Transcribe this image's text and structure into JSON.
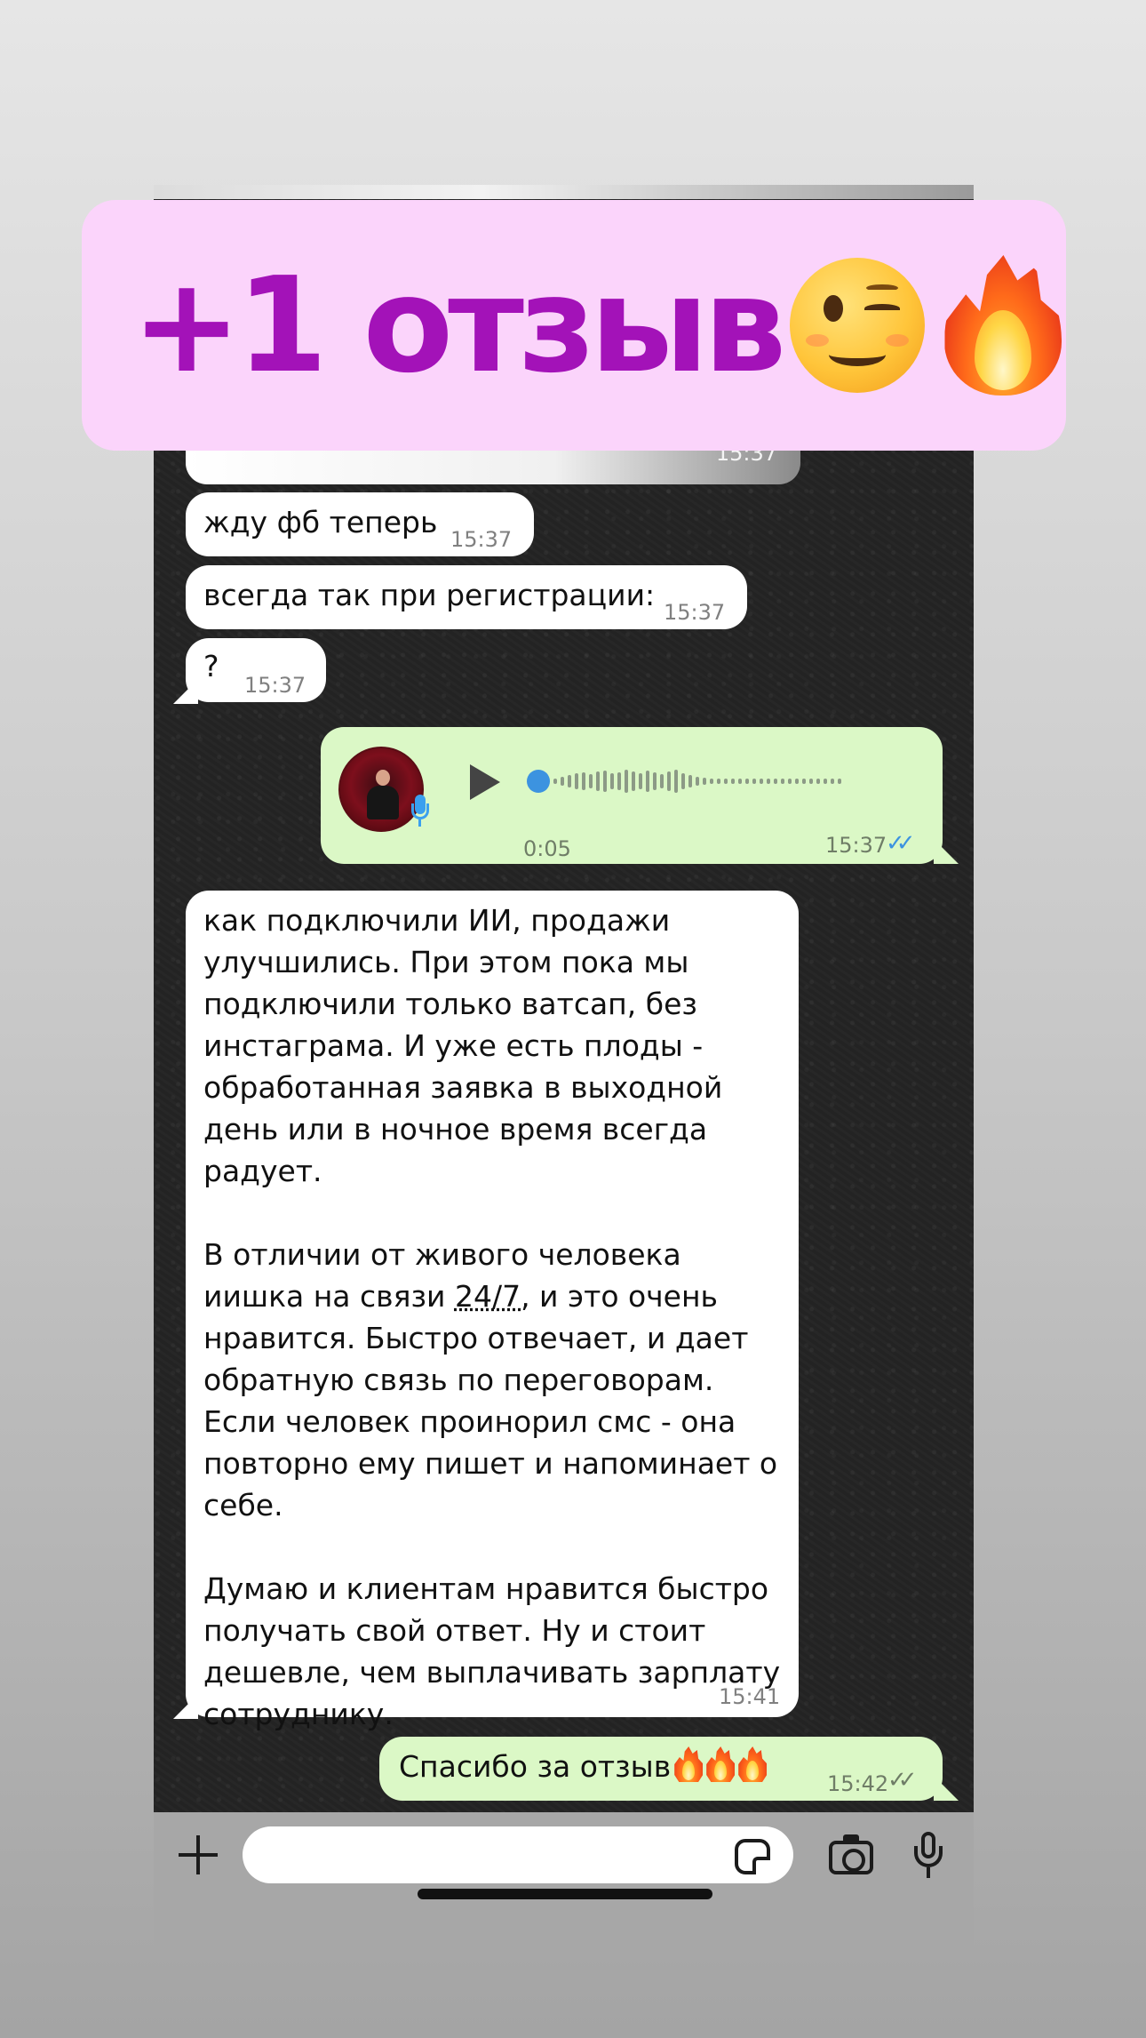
{
  "banner": {
    "text": "+1 отзыв"
  },
  "chat": {
    "partial_bubble_time": "15:37",
    "messages": [
      {
        "text": "жду фб теперь",
        "time": "15:37"
      },
      {
        "text": "всегда так при регистрации:",
        "time": "15:37"
      },
      {
        "text": "?",
        "time": "15:37"
      }
    ],
    "voice": {
      "duration": "0:05",
      "time": "15:37",
      "status": "read"
    },
    "long_message": {
      "p1": "как подключили ИИ, продажи улучшились. При этом пока мы подключили только ватсап, без инстаграма. И уже есть плоды - обработанная заявка в выходной день или в ночное время всегда радует.",
      "p2_a": "В отличии от живого человека иишка на связи ",
      "p2_link": "24/7",
      "p2_b": ", и это очень нравится. Быстро отвечает, и дает обратную связь по переговорам. Если человек проинорил смс - она повторно ему пишет и напоминает о себе.",
      "p3": "Думаю и клиентам нравится быстро получать свой ответ. Ну и стоит дешевле, чем выплачивать зарплату сотруднику.",
      "time": "15:41"
    },
    "reply": {
      "text": "Спасибо за отзыв",
      "time": "15:42",
      "status": "delivered"
    }
  },
  "input_bar": {
    "placeholder": ""
  },
  "icons": [
    "plus-icon",
    "sticker-icon",
    "camera-icon",
    "mic-icon",
    "play-icon",
    "wink-emoji-icon",
    "fire-emoji-icon"
  ],
  "colors": {
    "banner_bg": "#fbd4fb",
    "banner_text": "#a312b8",
    "incoming_bubble": "#ffffff",
    "outgoing_bubble": "#dbf8c6",
    "read_check": "#3c93e0"
  }
}
